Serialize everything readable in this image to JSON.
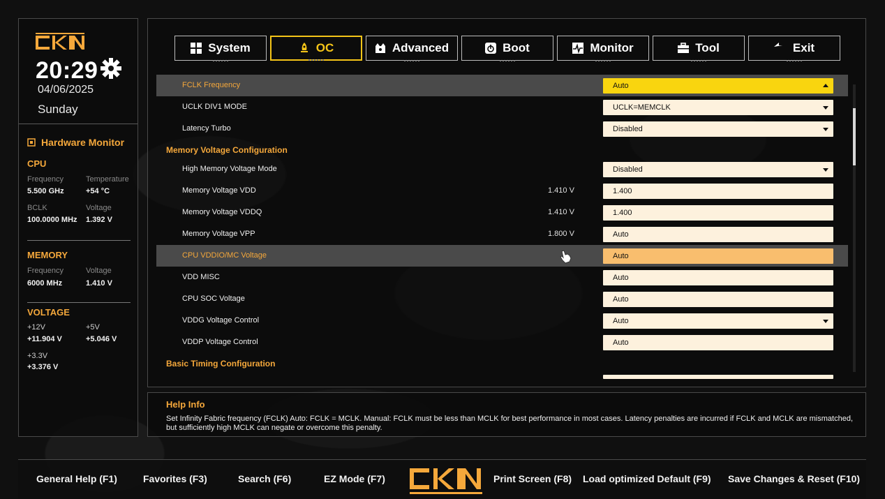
{
  "brand": {
    "logo": "CKN"
  },
  "clock": {
    "time": "20:29",
    "date": "04/06/2025",
    "day": "Sunday"
  },
  "hardware_monitor": {
    "title": "Hardware Monitor",
    "cpu": {
      "heading": "CPU",
      "frequency_label": "Frequency",
      "frequency": "5.500 GHz",
      "temperature_label": "Temperature",
      "temperature": "+54 °C",
      "bclk_label": "BCLK",
      "bclk": "100.0000 MHz",
      "voltage_label": "Voltage",
      "voltage": "1.392 V"
    },
    "memory": {
      "heading": "MEMORY",
      "frequency_label": "Frequency",
      "frequency": "6000 MHz",
      "voltage_label": "Voltage",
      "voltage": "1.410 V"
    },
    "voltage": {
      "heading": "VOLTAGE",
      "v12_label": "+12V",
      "v12": "+11.904 V",
      "v5_label": "+5V",
      "v5": "+5.046 V",
      "v33_label": "+3.3V",
      "v33": "+3.376 V"
    }
  },
  "tabs": [
    {
      "label": "System",
      "icon": "grid-icon"
    },
    {
      "label": "OC",
      "icon": "rocket-icon",
      "active": true
    },
    {
      "label": "Advanced",
      "icon": "chip-icon"
    },
    {
      "label": "Boot",
      "icon": "power-icon"
    },
    {
      "label": "Monitor",
      "icon": "pulse-icon"
    },
    {
      "label": "Tool",
      "icon": "toolbox-icon"
    },
    {
      "label": "Exit",
      "icon": "return-arrow-icon"
    }
  ],
  "settings": [
    {
      "label": "FCLK Frequency",
      "value": "Auto",
      "dropdown": true
    },
    {
      "label": "UCLK DIV1 MODE",
      "value": "UCLK=MEMCLK",
      "dropdown": true
    },
    {
      "label": "Latency Turbo",
      "value": "Disabled",
      "dropdown": true
    },
    {
      "section": "Memory Voltage Configuration"
    },
    {
      "label": "High Memory Voltage Mode",
      "value": "Disabled",
      "dropdown": true
    },
    {
      "label": "Memory Voltage VDD",
      "reading": "1.410 V",
      "value": "1.400"
    },
    {
      "label": "Memory Voltage VDDQ",
      "reading": "1.410 V",
      "value": "1.400"
    },
    {
      "label": "Memory Voltage VPP",
      "reading": "1.800 V",
      "value": "Auto"
    },
    {
      "label": "CPU VDDIO/MC Voltage",
      "value": "Auto"
    },
    {
      "label": "VDD MISC",
      "value": "Auto"
    },
    {
      "label": "CPU SOC Voltage",
      "value": "Auto"
    },
    {
      "label": "VDDG Voltage Control",
      "value": "Auto",
      "dropdown": true
    },
    {
      "label": "VDDP Voltage Control",
      "value": "Auto"
    },
    {
      "section": "Basic Timing Configuration"
    }
  ],
  "help": {
    "title": "Help Info",
    "text": "Set Infinity Fabric frequency (FCLK) Auto: FCLK = MCLK. Manual: FCLK must be less than MCLK for best performance in most cases. Latency penalties are incurred if FCLK and MCLK are mismatched, but sufficiently high MCLK can negate or overcome this penalty."
  },
  "footer": {
    "general_help": "General Help (F1)",
    "favorites": "Favorites (F3)",
    "search": "Search (F6)",
    "ez_mode": "EZ Mode (F7)",
    "print_screen": "Print Screen (F8)",
    "load_default": "Load optimized Default (F9)",
    "save_reset": "Save Changes & Reset (F10)"
  },
  "colors": {
    "accent_orange": "#f5a83b",
    "accent_yellow": "#f9d50f",
    "selected_field": "#f9be6e",
    "field_bg": "#fdf1dd"
  }
}
